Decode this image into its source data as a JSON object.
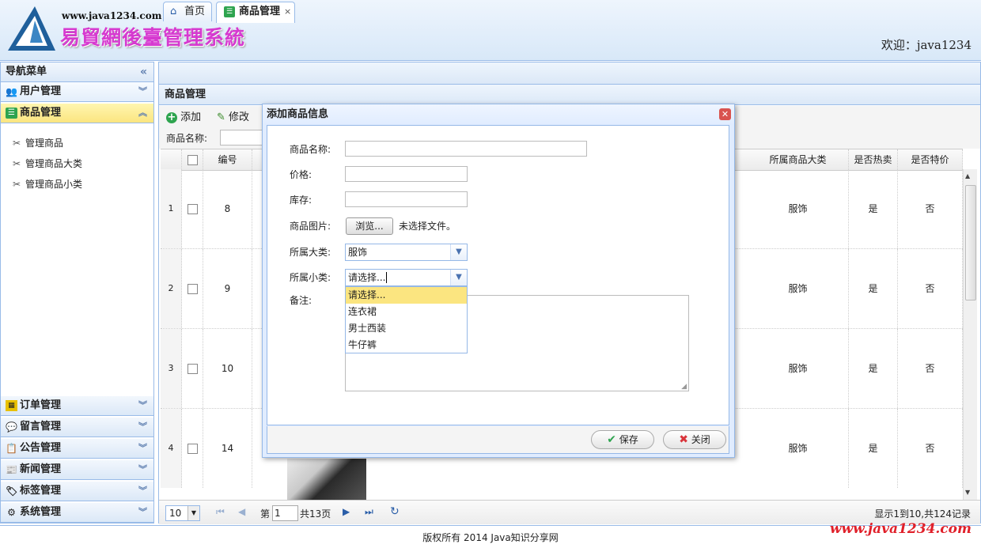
{
  "header": {
    "site_url": "www.java1234.com",
    "site_title": "易貿網後臺管理系統",
    "welcome": "欢迎：java1234"
  },
  "nav": {
    "title": "导航菜单",
    "collapse_icon": "double-chevron-left",
    "sections_top": [
      {
        "label": "用户管理",
        "icon": "users-icon"
      },
      {
        "label": "商品管理",
        "icon": "list-icon",
        "active": true
      }
    ],
    "items": [
      "管理商品",
      "管理商品大类",
      "管理商品小类"
    ],
    "sections_bottom": [
      {
        "label": "订单管理",
        "icon": "order-icon"
      },
      {
        "label": "留言管理",
        "icon": "message-icon"
      },
      {
        "label": "公告管理",
        "icon": "notice-icon"
      },
      {
        "label": "新闻管理",
        "icon": "news-icon"
      },
      {
        "label": "标签管理",
        "icon": "tag-icon"
      },
      {
        "label": "系统管理",
        "icon": "gear-icon"
      }
    ]
  },
  "tabs": [
    {
      "label": "首页",
      "icon": "home-icon"
    },
    {
      "label": "商品管理",
      "icon": "list-icon",
      "closable": true
    }
  ],
  "panel_title": "商品管理",
  "toolbar": {
    "add_label": "添加",
    "edit_label": "修改",
    "search_label": "商品名称:"
  },
  "grid": {
    "headers": {
      "id": "编号",
      "category": "所属商品大类",
      "hot": "是否热卖",
      "special": "是否特价"
    },
    "rows": [
      {
        "rownum": "1",
        "id": "8",
        "category": "服饰",
        "hot": "是",
        "special": "否"
      },
      {
        "rownum": "2",
        "id": "9",
        "category": "服饰",
        "hot": "是",
        "special": "否"
      },
      {
        "rownum": "3",
        "id": "10",
        "category": "服饰",
        "hot": "是",
        "special": "否"
      },
      {
        "rownum": "4",
        "id": "14",
        "category": "服饰",
        "hot": "是",
        "special": "否"
      }
    ]
  },
  "pager": {
    "page_size": "10",
    "page_prefix": "第",
    "page_value": "1",
    "page_total": "共13页",
    "summary": "显示1到10,共124记录"
  },
  "footer": {
    "copyright": "版权所有 2014 Java知识分享网",
    "watermark": "www.java1234.com"
  },
  "dialog": {
    "title": "添加商品信息",
    "fields": {
      "name_label": "商品名称:",
      "price_label": "价格:",
      "stock_label": "库存:",
      "image_label": "商品图片:",
      "browse_label": "浏览...",
      "no_file_text": "未选择文件。",
      "bigtype_label": "所属大类:",
      "bigtype_value": "服饰",
      "smalltype_label": "所属小类:",
      "smalltype_value": "请选择...",
      "remark_label": "备注:"
    },
    "dropdown_options": [
      "请选择...",
      "连衣裙",
      "男士西装",
      "牛仔裤"
    ],
    "save_label": "保存",
    "close_label": "关闭"
  },
  "colors": {
    "border_blue": "#99bbe8",
    "active_nav": "#fbe580",
    "title_pink": "#d63ad0",
    "watermark_red": "#e0202a"
  }
}
